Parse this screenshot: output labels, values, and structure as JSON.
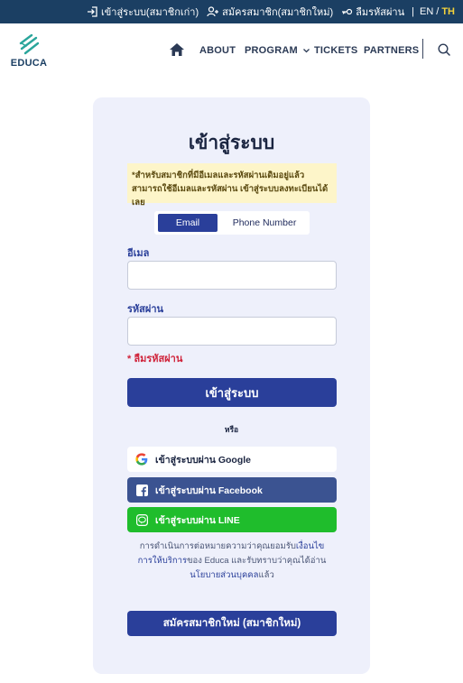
{
  "topbar": {
    "login_label": "เข้าสู่ระบบ(สมาชิกเก่า)",
    "register_label": "สมัครสมาชิก(สมาชิกใหม่)",
    "forgot_label": "ลืมรหัสผ่าน",
    "separator": "|",
    "lang_en": "EN",
    "lang_slash": "/",
    "lang_th": "TH"
  },
  "header": {
    "logo_text": "EDUCA",
    "nav": {
      "about": "ABOUT",
      "program": "PROGRAM",
      "tickets": "TICKETS",
      "partners": "PARTNERS"
    }
  },
  "login": {
    "title": "เข้าสู่ระบบ",
    "notice": "*สำหรับสมาชิกที่มีอีเมลและรหัสผ่านเดิมอยู่แล้ว สามารถใช้อีเมลและรหัสผ่าน เข้าสู่ระบบลงทะเบียนได้เลย",
    "tabs": {
      "email": "Email",
      "phone": "Phone Number",
      "active": "email"
    },
    "email_label": "อีเมล",
    "email_value": "",
    "password_label": "รหัสผ่าน",
    "password_value": "",
    "forgot_link": "* ลืมรหัสผ่าน",
    "submit_label": "เข้าสู่ระบบ",
    "or_label": "หรือ",
    "google_label": "เข้าสู่ระบบผ่าน Google",
    "facebook_label": "เข้าสู่ระบบผ่าน Facebook",
    "line_label": "เข้าสู่ระบบผ่าน LINE",
    "terms": {
      "part1": "การดำเนินการต่อหมายความว่าคุณยอมรับ",
      "link1": "เงื่อนไขการให้บริการ",
      "part2": "ของ Educa และรับทราบว่าคุณได้อ่าน",
      "link2": "นโยบายส่วนบุคคล",
      "part3": "แล้ว"
    },
    "register_label": "สมัครสมาชิกใหม่ (สมาชิกใหม่)"
  },
  "colors": {
    "topbar_bg": "#1b3f63",
    "accent": "#2a3f9a",
    "lang_active": "#f2d13b",
    "danger": "#d0243b",
    "facebook": "#3b5391",
    "line": "#1fbd2c",
    "notice_bg": "#fdf5c9",
    "card_bg": "#eef0fb"
  },
  "icons": {
    "login": "login-icon",
    "register": "add-user-icon",
    "forgot": "key-icon",
    "home": "home-icon",
    "search": "search-icon",
    "google": "google-icon",
    "facebook": "facebook-icon",
    "line": "line-icon"
  }
}
